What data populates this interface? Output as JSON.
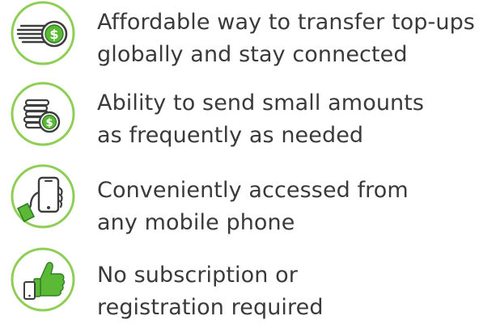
{
  "colors": {
    "ring": "#8fce55",
    "green": "#5cb936",
    "dark_green": "#2f7d26",
    "ink": "#3d3d3d",
    "text": "#3a3a3a"
  },
  "benefits": [
    {
      "icon": "fast-money-coin-icon",
      "lines": [
        "Affordable way to transfer top-ups",
        "globally and stay connected"
      ]
    },
    {
      "icon": "coin-stack-icon",
      "lines": [
        "Ability to send small amounts",
        "as frequently as needed"
      ]
    },
    {
      "icon": "hand-holding-phone-icon",
      "lines": [
        "Conveniently accessed from",
        "any mobile phone"
      ]
    },
    {
      "icon": "thumbs-up-phone-icon",
      "lines": [
        "No subscription or",
        "registration required"
      ]
    }
  ]
}
